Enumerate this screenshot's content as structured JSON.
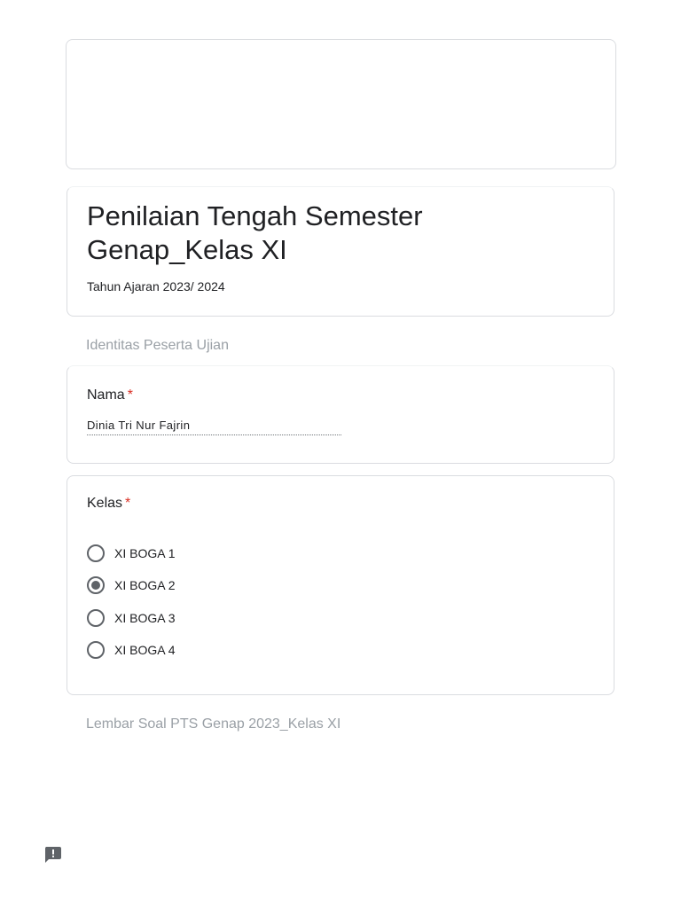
{
  "form": {
    "title": "Penilaian Tengah Semester Genap_Kelas XI",
    "description": "Tahun Ajaran 2023/ 2024"
  },
  "sections": [
    {
      "label": "Identitas Peserta Ujian"
    },
    {
      "label": "Lembar Soal PTS Genap 2023_Kelas XI"
    }
  ],
  "questions": {
    "nama": {
      "label": "Nama",
      "required_mark": "*",
      "answer": "Dinia Tri Nur Fajrin"
    },
    "kelas": {
      "label": "Kelas",
      "required_mark": "*",
      "selected": "XI BOGA 2",
      "options": [
        {
          "label": "XI BOGA 1"
        },
        {
          "label": "XI BOGA 2"
        },
        {
          "label": "XI BOGA 3"
        },
        {
          "label": "XI BOGA 4"
        }
      ]
    }
  },
  "icons": {
    "feedback": "feedback-icon"
  },
  "colors": {
    "required": "#d93025",
    "radio": "#5f6368",
    "section_label": "#9aa0a6",
    "card_border": "#dadce0"
  }
}
